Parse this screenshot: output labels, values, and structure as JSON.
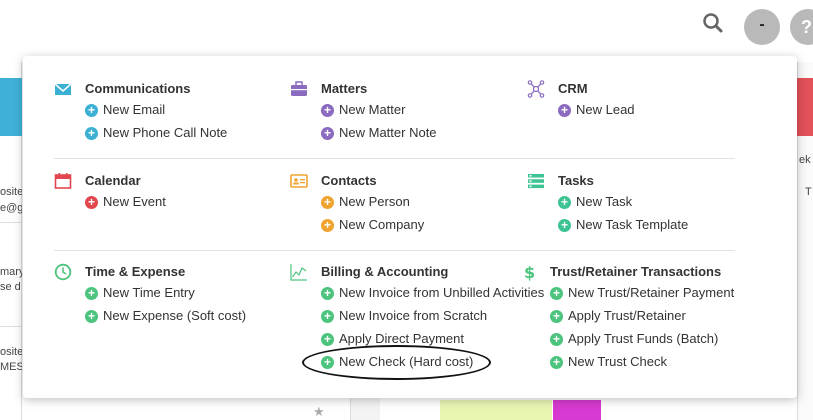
{
  "header": {
    "user_initial": "-",
    "help_label": "?"
  },
  "background": {
    "frag1": "osite:",
    "frag2": "e@g",
    "frag3": "mary",
    "frag4": "se d",
    "frag5": "osite:",
    "frag6": "MESS",
    "frag7": "ek",
    "frag8": "T"
  },
  "menu": {
    "communications": {
      "title": "Communications",
      "items": [
        "New Email",
        "New Phone Call Note"
      ]
    },
    "matters": {
      "title": "Matters",
      "items": [
        "New Matter",
        "New Matter Note"
      ]
    },
    "crm": {
      "title": "CRM",
      "items": [
        "New Lead"
      ]
    },
    "calendar": {
      "title": "Calendar",
      "items": [
        "New Event"
      ]
    },
    "contacts": {
      "title": "Contacts",
      "items": [
        "New Person",
        "New Company"
      ]
    },
    "tasks": {
      "title": "Tasks",
      "items": [
        "New Task",
        "New Task Template"
      ]
    },
    "time_expense": {
      "title": "Time & Expense",
      "items": [
        "New Time Entry",
        "New Expense (Soft cost)"
      ]
    },
    "billing": {
      "title": "Billing & Accounting",
      "items": [
        "New Invoice from Unbilled Activities",
        "New Invoice from Scratch",
        "Apply Direct Payment",
        "New Check (Hard cost)"
      ]
    },
    "trust": {
      "title": "Trust/Retainer Transactions",
      "items": [
        "New Trust/Retainer Payment",
        "Apply Trust/Retainer",
        "Apply Trust Funds (Batch)",
        "New Trust Check"
      ]
    }
  },
  "colors": {
    "communications": "#3bb0d3",
    "matters": "#8a6bbf",
    "calendar": "#e2474f",
    "contacts": "#f0a430",
    "tasks": "#3ec493",
    "time_expense": "#4cc47e"
  }
}
